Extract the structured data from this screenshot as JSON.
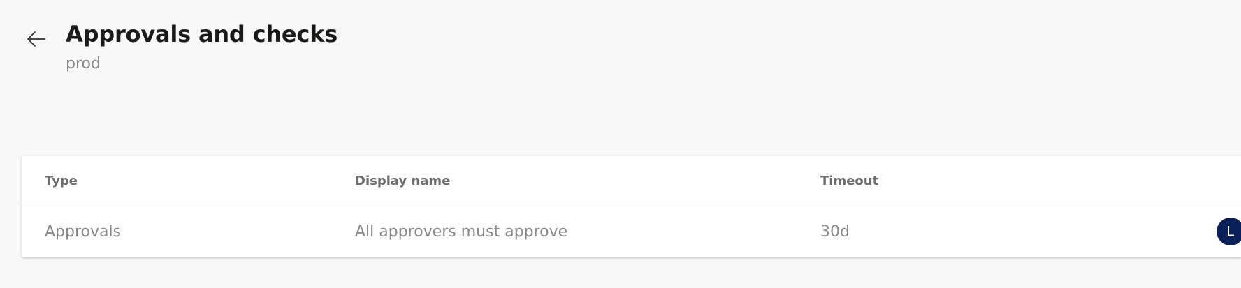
{
  "header": {
    "title": "Approvals and checks",
    "subtitle": "prod",
    "back_icon": "arrow-left-icon"
  },
  "table": {
    "columns": [
      "Type",
      "Display name",
      "Timeout"
    ],
    "rows": [
      {
        "type": "Approvals",
        "display_name": "All approvers must approve",
        "timeout": "30d",
        "avatar_initial": "L",
        "avatar_color": "#0a2158"
      }
    ]
  }
}
